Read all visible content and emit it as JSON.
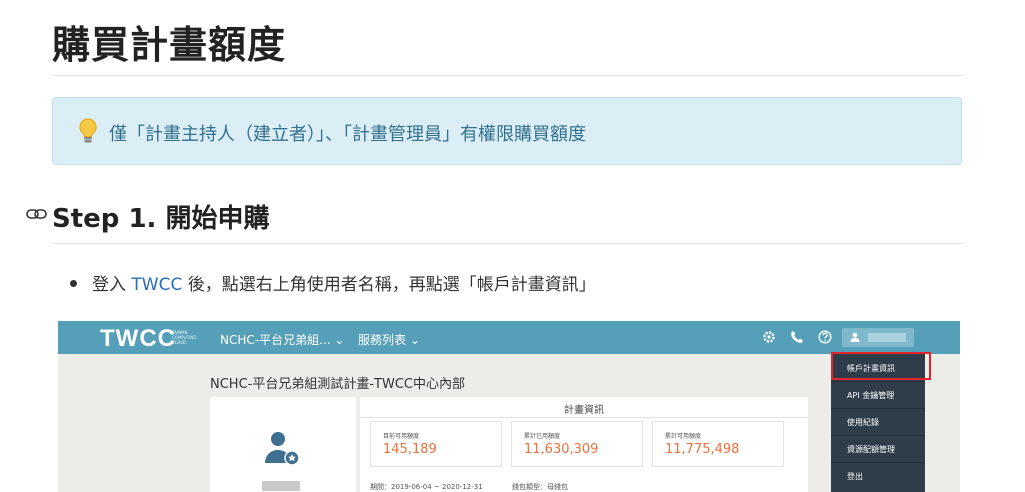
{
  "page": {
    "title": "購買計畫額度",
    "tip_text": "僅「計畫主持人（建立者）」、「計畫管理員」有權限購買額度",
    "step_heading": "Step 1. 開始申購",
    "bullet": {
      "before_link": "登入 ",
      "link_text": "TWCC",
      "after_link": " 後，點選右上角使用者名稱，再點選「帳戶計畫資訊」"
    }
  },
  "screenshot": {
    "logo": "TWCC",
    "logo_sub": "TAIWAN COMPUTING CLOUD",
    "nav_project": "NCHC-平台兄弟組... ⌄",
    "nav_services": "服務列表 ⌄",
    "project_title": "NCHC-平台兄弟組測試計畫-TWCC中心內部",
    "info_title": "計畫資訊",
    "stats": [
      {
        "label": "目前可用額度",
        "value": "145,189"
      },
      {
        "label": "累計已用額度",
        "value": "11,630,309"
      },
      {
        "label": "累計可用額度",
        "value": "11,775,498"
      }
    ],
    "period": "期間：2019-06-04 ~ 2020-12-31",
    "wallet_type": "錢包類型：母錢包",
    "dropdown": [
      "帳戶計畫資訊",
      "API 金鑰管理",
      "使用紀錄",
      "資源配額管理",
      "登出"
    ]
  },
  "colors": {
    "nav_bg": "#55a0b8",
    "tip_bg": "#dbeef5",
    "tip_text": "#31708f",
    "accent_value": "#ee6f40",
    "highlight_border": "#e1232a",
    "link": "#2a6ebb"
  },
  "icons": [
    "lightbulb-icon",
    "link-anchor-icon",
    "gear-icon",
    "phone-icon",
    "help-icon",
    "user-icon",
    "user-avatar-icon"
  ]
}
